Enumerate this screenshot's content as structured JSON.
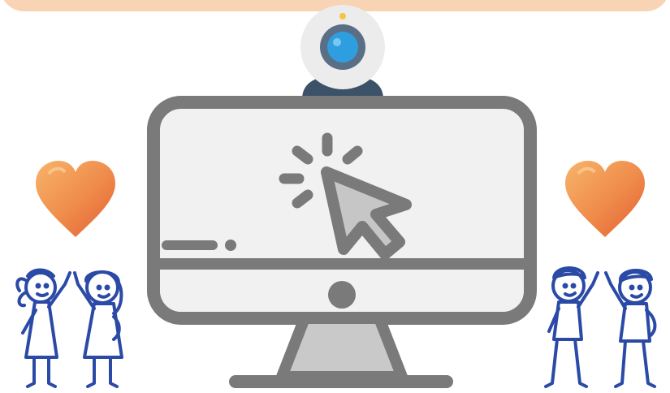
{
  "colors": {
    "banner": "#f8d4b4",
    "monitor_frame": "#7a7a7a",
    "screen": "#f1f1f1",
    "stand": "#c9c9c9",
    "webcam_body": "#ececec",
    "webcam_base": "#3c5269",
    "webcam_lens": "#2f9ee0",
    "webcam_led": "#f5c542",
    "cursor_fill": "#c6c6c6",
    "heart_a": "#f4a25a",
    "heart_b": "#e8673a",
    "kids_ink": "#2b4aa6"
  },
  "icons": {
    "camera": "webcam-icon",
    "monitor": "monitor-icon",
    "cursor": "cursor-click-icon",
    "heart_left": "heart-icon",
    "heart_right": "heart-icon",
    "kids_left": "girls-high-five-icon",
    "kids_right": "boys-high-five-icon"
  }
}
